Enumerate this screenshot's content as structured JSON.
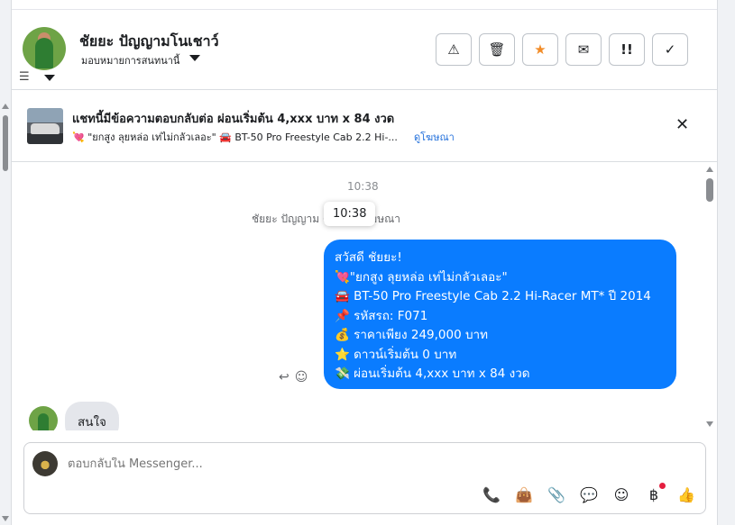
{
  "header": {
    "contact_name": "ชัยยะ ปัญญามโนเชาว์",
    "assigned_label": "มอบหมายการสนทนานี้",
    "actions": [
      {
        "name": "report-spam-button",
        "icon": "warning-icon",
        "glyph": "⚠"
      },
      {
        "name": "delete-button",
        "icon": "trash-icon",
        "glyph": "🗑"
      },
      {
        "name": "star-button",
        "icon": "star-icon",
        "glyph": "★"
      },
      {
        "name": "mark-unread-button",
        "icon": "envelope-icon",
        "glyph": "✉"
      },
      {
        "name": "follow-up-button",
        "icon": "follow-up-icon",
        "glyph": "!!"
      },
      {
        "name": "mark-done-button",
        "icon": "check-icon",
        "glyph": "✓"
      }
    ]
  },
  "ad_banner": {
    "title": "แชทนี้มีข้อความตอบกลับต่อ ผ่อนเริ่มต้น 4,xxx บาท x 84 งวด",
    "subtitle": "💘 \"ยกสูง ลุยหล่อ เท่ไม่กลัวเลอะ\"  🚘 BT-50 Pro Freestyle Cab 2.2 Hi-...",
    "link": "ดูโฆษณา",
    "close_glyph": "✕"
  },
  "thread": {
    "timestamp": "10:38",
    "system_note": "ชัยยะ ปัญญาม        ตอบกลับโฆษณา",
    "tooltip": "10:38",
    "outgoing_lines": [
      "สวัสดี ชัยยะ!",
      "💘\"ยกสูง ลุยหล่อ เท่ไม่กลัวเลอะ\"",
      "🚘 BT-50 Pro Freestyle Cab 2.2 Hi-Racer MT* ปี 2014",
      "📌 รหัสรถ: F071",
      "💰 ราคาเพียง 249,000 บาท",
      "⭐ ดาวน์เริ่มต้น 0 บาท",
      "💸 ผ่อนเริ่มต้น 4,xxx บาท x 84 งวด"
    ],
    "incoming_text": "สนใจ"
  },
  "composer": {
    "placeholder": "ตอบกลับใน Messenger...",
    "icons": [
      {
        "name": "call-icon",
        "glyph": "📞"
      },
      {
        "name": "shopping-bag-icon",
        "glyph": "👜"
      },
      {
        "name": "paperclip-icon",
        "glyph": "📎"
      },
      {
        "name": "saved-replies-icon",
        "glyph": "💬"
      },
      {
        "name": "emoji-icon",
        "glyph": "☺"
      },
      {
        "name": "baht-payment-icon",
        "glyph": "฿"
      },
      {
        "name": "thumbs-up-icon",
        "glyph": "👍"
      }
    ]
  }
}
